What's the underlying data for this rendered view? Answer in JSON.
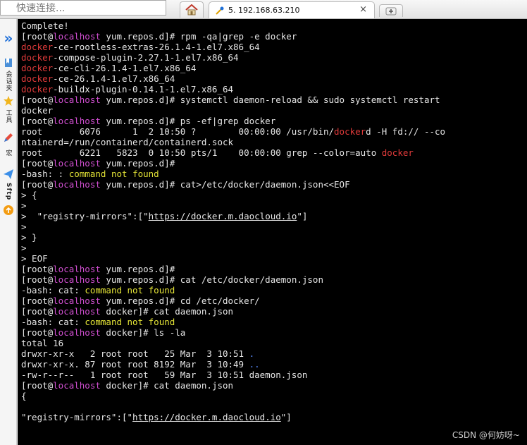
{
  "toolbar": {
    "quick_connect_placeholder": "快速连接...",
    "home_icon": "home-icon",
    "session_tab": {
      "icon": "session-icon",
      "title": "5. 192.168.63.210",
      "close": "×"
    },
    "new_tab_icon": "new-tab-icon"
  },
  "sidebar": {
    "toggle_glyph": "»",
    "items": [
      {
        "icon": "bookmark-icon",
        "label": "会话夹"
      },
      {
        "icon": "star-icon",
        "label": "工具"
      },
      {
        "icon": "edit-icon",
        "label": "宏"
      },
      {
        "icon": "sftp-icon",
        "label": "Sftp"
      }
    ]
  },
  "terminal": {
    "lines": [
      [
        {
          "t": "Complete!"
        }
      ],
      [
        {
          "t": "[root@"
        },
        {
          "t": "localhost",
          "c": "mag"
        },
        {
          "t": " yum.repos.d]# rpm -qa|grep -e docker"
        }
      ],
      [
        {
          "t": "docker",
          "c": "red"
        },
        {
          "t": "-ce-rootless-extras-26.1.4-1.el7.x86_64"
        }
      ],
      [
        {
          "t": "docker",
          "c": "red"
        },
        {
          "t": "-compose-plugin-2.27.1-1.el7.x86_64"
        }
      ],
      [
        {
          "t": "docker",
          "c": "red"
        },
        {
          "t": "-ce-cli-26.1.4-1.el7.x86_64"
        }
      ],
      [
        {
          "t": "docker",
          "c": "red"
        },
        {
          "t": "-ce-26.1.4-1.el7.x86_64"
        }
      ],
      [
        {
          "t": "docker",
          "c": "red"
        },
        {
          "t": "-buildx-plugin-0.14.1-1.el7.x86_64"
        }
      ],
      [
        {
          "t": "[root@"
        },
        {
          "t": "localhost",
          "c": "mag"
        },
        {
          "t": " yum.repos.d]# systemctl daemon-reload && sudo systemctl restart"
        }
      ],
      [
        {
          "t": "docker"
        }
      ],
      [
        {
          "t": "[root@"
        },
        {
          "t": "localhost",
          "c": "mag"
        },
        {
          "t": " yum.repos.d]# ps -ef|grep docker"
        }
      ],
      [
        {
          "t": "root       6076      1  2 10:50 ?        00:00:00 /usr/bin/"
        },
        {
          "t": "docker",
          "c": "red"
        },
        {
          "t": "d -H fd:// --co"
        }
      ],
      [
        {
          "t": "ntainerd=/run/containerd/containerd.sock"
        }
      ],
      [
        {
          "t": "root       6221   5823  0 10:50 pts/1    00:00:00 grep --color=auto "
        },
        {
          "t": "docker",
          "c": "red"
        }
      ],
      [
        {
          "t": "[root@"
        },
        {
          "t": "localhost",
          "c": "mag"
        },
        {
          "t": " yum.repos.d]#"
        }
      ],
      [
        {
          "t": "-bash: : "
        },
        {
          "t": "command",
          "c": "yel"
        },
        {
          "t": " "
        },
        {
          "t": "not",
          "c": "yel"
        },
        {
          "t": " "
        },
        {
          "t": "found",
          "c": "yel"
        }
      ],
      [
        {
          "t": "[root@"
        },
        {
          "t": "localhost",
          "c": "mag"
        },
        {
          "t": " yum.repos.d]# cat>/etc/docker/daemon.json<<EOF"
        }
      ],
      [
        {
          "t": "> {"
        }
      ],
      [
        {
          "t": ">"
        }
      ],
      [
        {
          "t": ">  \"registry-mirrors\":[\""
        },
        {
          "t": "https://docker.m.daocloud.io",
          "c": "lnk"
        },
        {
          "t": "\"]"
        }
      ],
      [
        {
          "t": ">"
        }
      ],
      [
        {
          "t": "> }"
        }
      ],
      [
        {
          "t": ">"
        }
      ],
      [
        {
          "t": "> EOF"
        }
      ],
      [
        {
          "t": "[root@"
        },
        {
          "t": "localhost",
          "c": "mag"
        },
        {
          "t": " yum.repos.d]#"
        }
      ],
      [
        {
          "t": "[root@"
        },
        {
          "t": "localhost",
          "c": "mag"
        },
        {
          "t": " yum.repos.d]# cat /etc/docker/daemon.json"
        }
      ],
      [
        {
          "t": "-bash: cat: "
        },
        {
          "t": "command",
          "c": "yel"
        },
        {
          "t": " "
        },
        {
          "t": "not",
          "c": "yel"
        },
        {
          "t": " "
        },
        {
          "t": "found",
          "c": "yel"
        }
      ],
      [
        {
          "t": "[root@"
        },
        {
          "t": "localhost",
          "c": "mag"
        },
        {
          "t": " yum.repos.d]# cd /etc/docker/"
        }
      ],
      [
        {
          "t": "[root@"
        },
        {
          "t": "localhost",
          "c": "mag"
        },
        {
          "t": " docker]# cat daemon.json"
        }
      ],
      [
        {
          "t": "-bash: cat: "
        },
        {
          "t": "command",
          "c": "yel"
        },
        {
          "t": " "
        },
        {
          "t": "not",
          "c": "yel"
        },
        {
          "t": " "
        },
        {
          "t": "found",
          "c": "yel"
        }
      ],
      [
        {
          "t": "[root@"
        },
        {
          "t": "localhost",
          "c": "mag"
        },
        {
          "t": " docker]# ls -la"
        }
      ],
      [
        {
          "t": "total 16"
        }
      ],
      [
        {
          "t": "drwxr-xr-x   2 root root   25 Mar  3 10:51 "
        },
        {
          "t": ".",
          "c": "blu"
        }
      ],
      [
        {
          "t": "drwxr-xr-x. 87 root root 8192 Mar  3 10:49 "
        },
        {
          "t": "..",
          "c": "blu"
        }
      ],
      [
        {
          "t": "-rw-r--r--   1 root root   59 Mar  3 10:51 daemon.json"
        }
      ],
      [
        {
          "t": "[root@"
        },
        {
          "t": "localhost",
          "c": "mag"
        },
        {
          "t": " docker]# cat daemon.json"
        }
      ],
      [
        {
          "t": "{"
        }
      ],
      [
        {
          "t": ""
        }
      ],
      [
        {
          "t": "\"registry-mirrors\":[\""
        },
        {
          "t": "https://docker.m.daocloud.io",
          "c": "lnk"
        },
        {
          "t": "\"]"
        }
      ]
    ]
  },
  "watermark": "CSDN @何妨呀~",
  "colors": {
    "terminal_bg": "#000000",
    "text": "#e6e6e6",
    "host": "#d14fd1",
    "match": "#e03a3a",
    "error": "#e2e236",
    "dir": "#5a8cff"
  }
}
